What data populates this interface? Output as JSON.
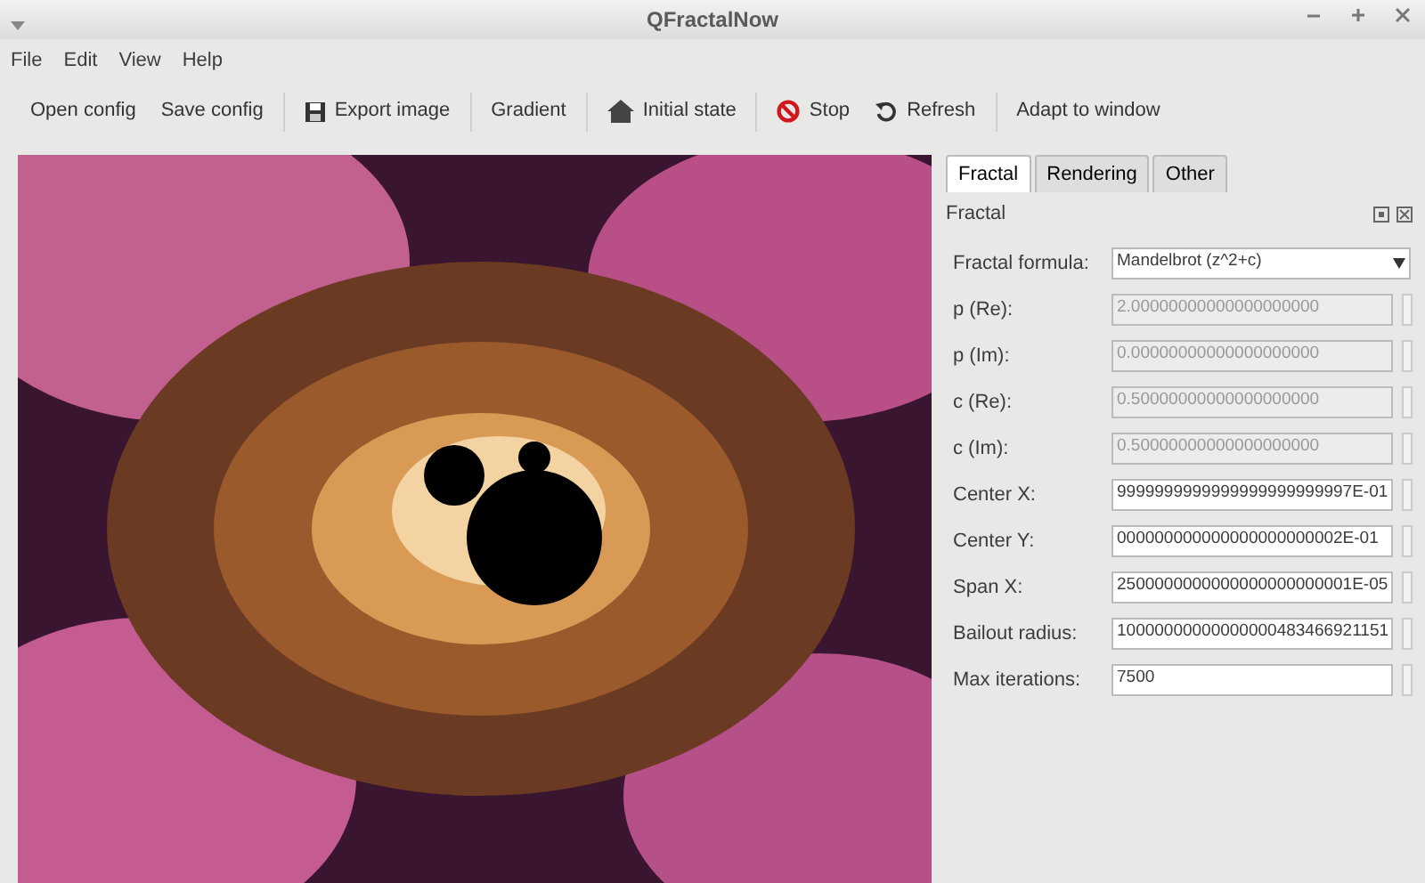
{
  "window": {
    "title": "QFractalNow"
  },
  "menu": [
    "File",
    "Edit",
    "View",
    "Help"
  ],
  "toolbar": [
    "Open config",
    "Save config",
    "Export image",
    "Gradient",
    "Initial state",
    "Stop",
    "Refresh",
    "Adapt to window"
  ],
  "tabs": [
    {
      "label": "Fractal",
      "selected": true
    },
    {
      "label": "Rendering",
      "selected": false
    },
    {
      "label": "Other",
      "selected": false
    }
  ],
  "panel": {
    "title": "Fractal",
    "fields": [
      {
        "label": "Fractal formula:",
        "kind": "combo",
        "value": "Mandelbrot (z^2+c)",
        "disabled": false
      },
      {
        "label": "p (Re):",
        "kind": "spin",
        "value": "2.00000000000000000000",
        "disabled": true
      },
      {
        "label": "p (Im):",
        "kind": "spin",
        "value": "0.00000000000000000000",
        "disabled": true
      },
      {
        "label": "c (Re):",
        "kind": "spin",
        "value": "0.50000000000000000000",
        "disabled": true
      },
      {
        "label": "c (Im):",
        "kind": "spin",
        "value": "0.50000000000000000000",
        "disabled": true
      },
      {
        "label": "Center X:",
        "kind": "spin",
        "value": "9999999999999999999999997E-01",
        "disabled": false
      },
      {
        "label": "Center Y:",
        "kind": "spin",
        "value": "000000000000000000000002E-01",
        "disabled": false
      },
      {
        "label": "Span X:",
        "kind": "spin",
        "value": "2500000000000000000000001E-05",
        "disabled": false
      },
      {
        "label": "Bailout radius:",
        "kind": "spin",
        "value": "10000000000000000483466921151",
        "disabled": false
      },
      {
        "label": "Max iterations:",
        "kind": "spin",
        "value": "7500",
        "disabled": false
      }
    ]
  }
}
